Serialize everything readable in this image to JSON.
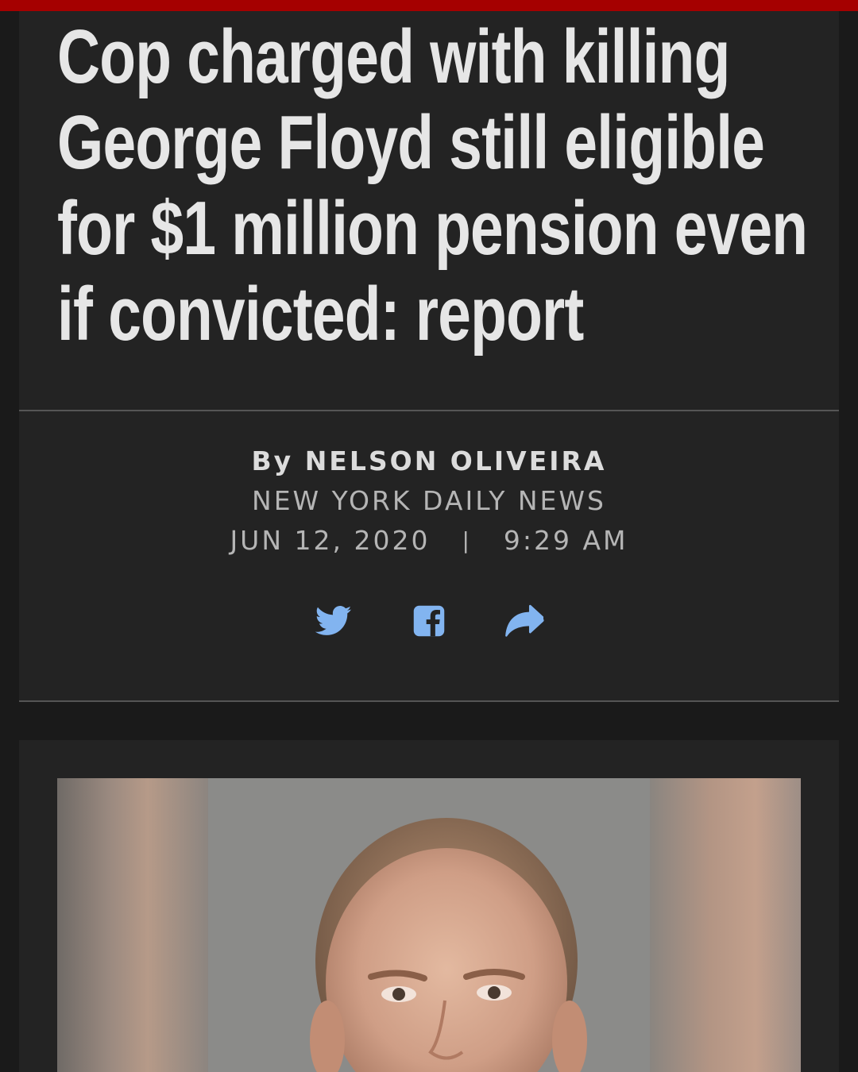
{
  "article": {
    "headline": "Cop charged with killing George Floyd still eligible for $1 million pension even if convicted: report",
    "byline_prefix": "By",
    "author": "NELSON OLIVEIRA",
    "publication": "NEW YORK DAILY NEWS",
    "date": "JUN 12, 2020",
    "separator": "|",
    "time": "9:29 AM"
  },
  "share": {
    "icons": [
      "twitter-icon",
      "facebook-icon",
      "share-icon"
    ],
    "icon_color": "#82b4f0"
  },
  "colors": {
    "accent_bar": "#a50000",
    "background": "#1a1a1a",
    "panel": "#232323",
    "headline_text": "#e6e6e6"
  }
}
